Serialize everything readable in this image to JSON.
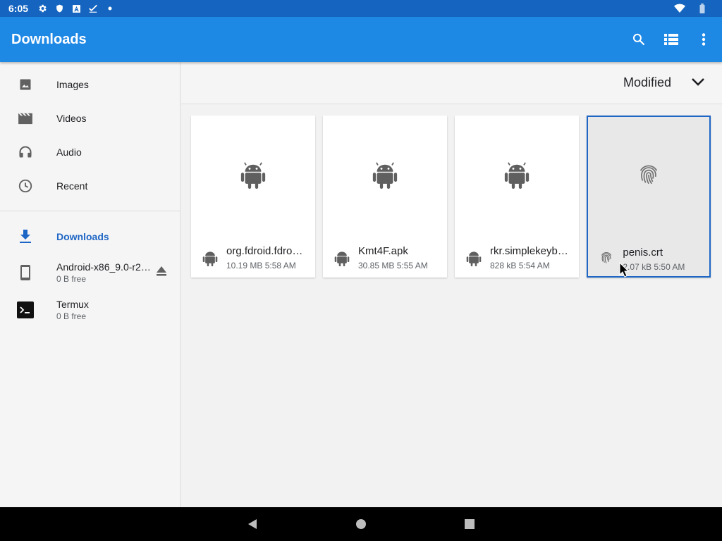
{
  "status": {
    "time": "6:05",
    "icons": [
      "gear-icon",
      "shield-icon",
      "a-icon",
      "check-icon",
      "dot-icon"
    ],
    "right_icons": [
      "wifi-icon",
      "battery-icon"
    ]
  },
  "appbar": {
    "title": "Downloads",
    "actions": [
      "search-icon",
      "list-view-icon",
      "more-vert-icon"
    ]
  },
  "drawer": {
    "items": [
      {
        "label": "Images",
        "icon": "image-icon"
      },
      {
        "label": "Videos",
        "icon": "movie-icon"
      },
      {
        "label": "Audio",
        "icon": "headphones-icon"
      },
      {
        "label": "Recent",
        "icon": "clock-icon"
      }
    ],
    "roots": [
      {
        "label": "Downloads",
        "icon": "download-icon",
        "active": true
      },
      {
        "label": "Android-x86_9.0-r2…",
        "sub": "0 B free",
        "icon": "phone-icon",
        "eject": true
      },
      {
        "label": "Termux",
        "sub": "0 B free",
        "icon": "terminal-icon"
      }
    ]
  },
  "sort": {
    "label": "Modified",
    "icon": "chevron-down-icon"
  },
  "files": [
    {
      "name": "org.fdroid.fdro…",
      "info": "10.19 MB 5:58 AM",
      "icon": "android-icon"
    },
    {
      "name": "Kmt4F.apk",
      "info": "30.85 MB 5:55 AM",
      "icon": "android-icon"
    },
    {
      "name": "rkr.simplekeyb…",
      "info": "828 kB 5:54 AM",
      "icon": "android-icon"
    },
    {
      "name": "penis.crt",
      "info": "2.07 kB 5:50 AM",
      "icon": "fingerprint-icon",
      "selected": true
    }
  ],
  "navbar": [
    "back-icon",
    "home-icon",
    "recents-icon"
  ],
  "colors": {
    "statusbar": "#1565c0",
    "appbar": "#1e88e5",
    "accent": "#1e66c5"
  }
}
